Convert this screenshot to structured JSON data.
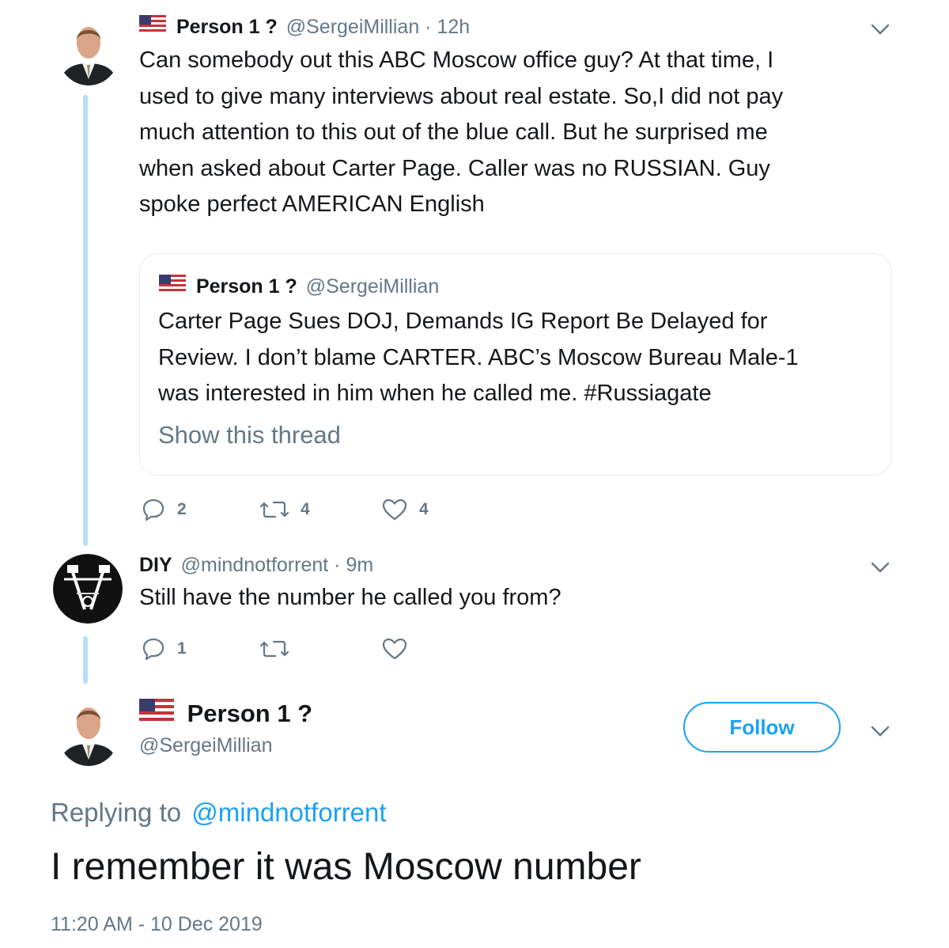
{
  "tweet1": {
    "display_name": "Person 1 ?",
    "handle": "@SergeiMillian",
    "time": "· 12h",
    "text_lines": [
      "Can somebody out this ABC Moscow office guy? At that time, I",
      "used to give many interviews about real estate. So,I did not pay",
      "much attention to this out of the blue call.  But he surprised me",
      "when asked about Carter Page. Caller was no RUSSIAN. Guy",
      "spoke perfect AMERICAN English"
    ],
    "quote": {
      "display_name": "Person 1 ?",
      "handle": "@SergeiMillian",
      "text_lines": [
        "Carter Page Sues DOJ, Demands IG Report Be Delayed for",
        "Review. I don’t blame CARTER. ABC’s Moscow Bureau Male-1",
        "was interested in him when he called me. #Russiagate"
      ],
      "show_thread": "Show this thread"
    },
    "replies": "2",
    "retweets": "4",
    "likes": "4"
  },
  "tweet2": {
    "display_name": "DIY",
    "handle": "@mindnotforrent",
    "time": "· 9m",
    "text": "Still have the number he called you from?",
    "replies": "1"
  },
  "main_tweet": {
    "display_name": "Person 1 ?",
    "handle": "@SergeiMillian",
    "follow_label": "Follow",
    "replying_prefix": "Replying to",
    "replying_handle": "@mindnotforrent",
    "text": "I remember it was Moscow number",
    "timestamp": "11:20 AM - 10 Dec 2019"
  },
  "colors": {
    "accent": "#1da1f2",
    "muted": "#657786",
    "thread_line": "#b8dcf7"
  }
}
